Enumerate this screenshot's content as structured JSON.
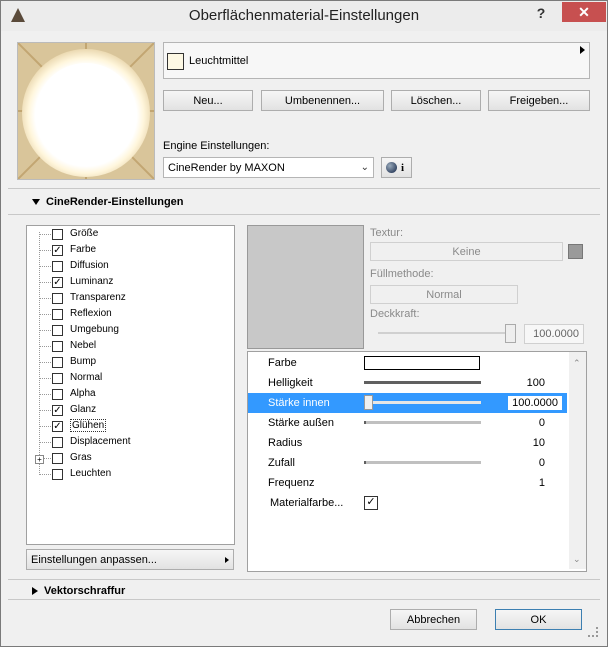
{
  "window": {
    "title": "Oberflächenmaterial-Einstellungen",
    "help": "?",
    "close": "✕"
  },
  "material": {
    "name": "Leuchtmittel",
    "swatch_color": "#fdf8e4"
  },
  "buttons": {
    "new": "Neu...",
    "rename": "Umbenennen...",
    "delete": "Löschen...",
    "share": "Freigeben..."
  },
  "engine": {
    "label": "Engine Einstellungen:",
    "selected": "CineRender by MAXON",
    "info": "i"
  },
  "section_cinerender": "CineRender-Einstellungen",
  "section_vector": "Vektorschraffur",
  "channels": [
    {
      "label": "Größe",
      "checked": false
    },
    {
      "label": "Farbe",
      "checked": true
    },
    {
      "label": "Diffusion",
      "checked": false
    },
    {
      "label": "Luminanz",
      "checked": true
    },
    {
      "label": "Transparenz",
      "checked": false
    },
    {
      "label": "Reflexion",
      "checked": false
    },
    {
      "label": "Umgebung",
      "checked": false
    },
    {
      "label": "Nebel",
      "checked": false
    },
    {
      "label": "Bump",
      "checked": false
    },
    {
      "label": "Normal",
      "checked": false
    },
    {
      "label": "Alpha",
      "checked": false
    },
    {
      "label": "Glanz",
      "checked": true
    },
    {
      "label": "Glühen",
      "checked": true
    },
    {
      "label": "Displacement",
      "checked": false
    },
    {
      "label": "Gras",
      "checked": false
    },
    {
      "label": "Leuchten",
      "checked": false
    }
  ],
  "adjust_button": "Einstellungen anpassen...",
  "texture": {
    "label": "Textur:",
    "value": "Keine",
    "fill_label": "Füllmethode:",
    "fill_value": "Normal",
    "opacity_label": "Deckkraft:",
    "opacity_value": "100.0000",
    "opacity_fraction": 1.0
  },
  "params": [
    {
      "label": "Farbe",
      "value": "",
      "type": "color",
      "color": "#ffffff"
    },
    {
      "label": "Helligkeit",
      "value": "100",
      "type": "slider",
      "fraction": 1.0
    },
    {
      "label": "Stärke innen",
      "value": "100.0000",
      "type": "slider",
      "fraction": 0.0,
      "selected": true
    },
    {
      "label": "Stärke außen",
      "value": "0",
      "type": "slider",
      "fraction": 0.0
    },
    {
      "label": "Radius",
      "value": "10",
      "type": "none"
    },
    {
      "label": "Zufall",
      "value": "0",
      "type": "slider",
      "fraction": 0.0
    },
    {
      "label": "Frequenz",
      "value": "1",
      "type": "none"
    },
    {
      "label": "Materialfarbe...",
      "value": "",
      "type": "checkbox",
      "checked": true
    }
  ],
  "footer": {
    "cancel": "Abbrechen",
    "ok": "OK"
  },
  "colors": {
    "selection": "#3399ff",
    "close": "#c75050"
  }
}
